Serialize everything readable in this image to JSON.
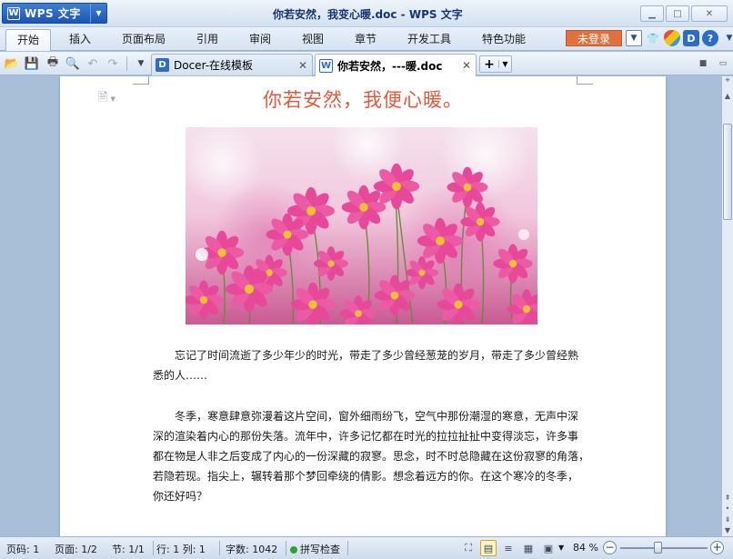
{
  "app": {
    "name": "WPS 文字",
    "window_title": "你若安然，我变心暖.doc - WPS 文字"
  },
  "menu": {
    "items": [
      "开始",
      "插入",
      "页面布局",
      "引用",
      "审阅",
      "视图",
      "章节",
      "开发工具",
      "特色功能"
    ],
    "login": "未登录"
  },
  "tabs": [
    {
      "label": "Docer-在线模板",
      "icon": "docer-icon"
    },
    {
      "label": "你若安然，---暖.doc",
      "icon": "wps-doc-icon"
    }
  ],
  "document": {
    "heading": "你若安然，我便心暖。",
    "paragraph1": [
      "忘记了时间流逝了多少年少的时光，带走了多少曾经葱茏的岁月，带走了多少曾经熟",
      "悉的人……"
    ],
    "paragraph2": [
      "冬季，寒意肆意弥漫着这片空间，窗外细雨纷飞，空气中那份潮湿的寒意，无声中深",
      "深的渲染着内心的那份失落。流年中，许多记忆都在时光的拉拉扯扯中变得淡忘，许多事",
      "都在物是人非之后变成了内心的一份深藏的寂寥。思念，时不时总隐藏在这份寂寥的角落，",
      "若隐若现。指尖上，辗转着那个梦回牵绕的倩影。想念着远方的你。在这个寒冷的冬季，",
      "你还好吗？"
    ]
  },
  "status": {
    "page": "页码: 1",
    "pages": "页面: 1/2",
    "section": "节: 1/1",
    "line_col": "行: 1  列: 1",
    "word_count": "字数: 1042",
    "spell_check": "拼写检查",
    "zoom": "84 %",
    "zoom_fraction": 0.44
  },
  "colors": {
    "heading": "#e2593d",
    "login_button": "#e0703c",
    "app_button": "#1c54b4"
  }
}
